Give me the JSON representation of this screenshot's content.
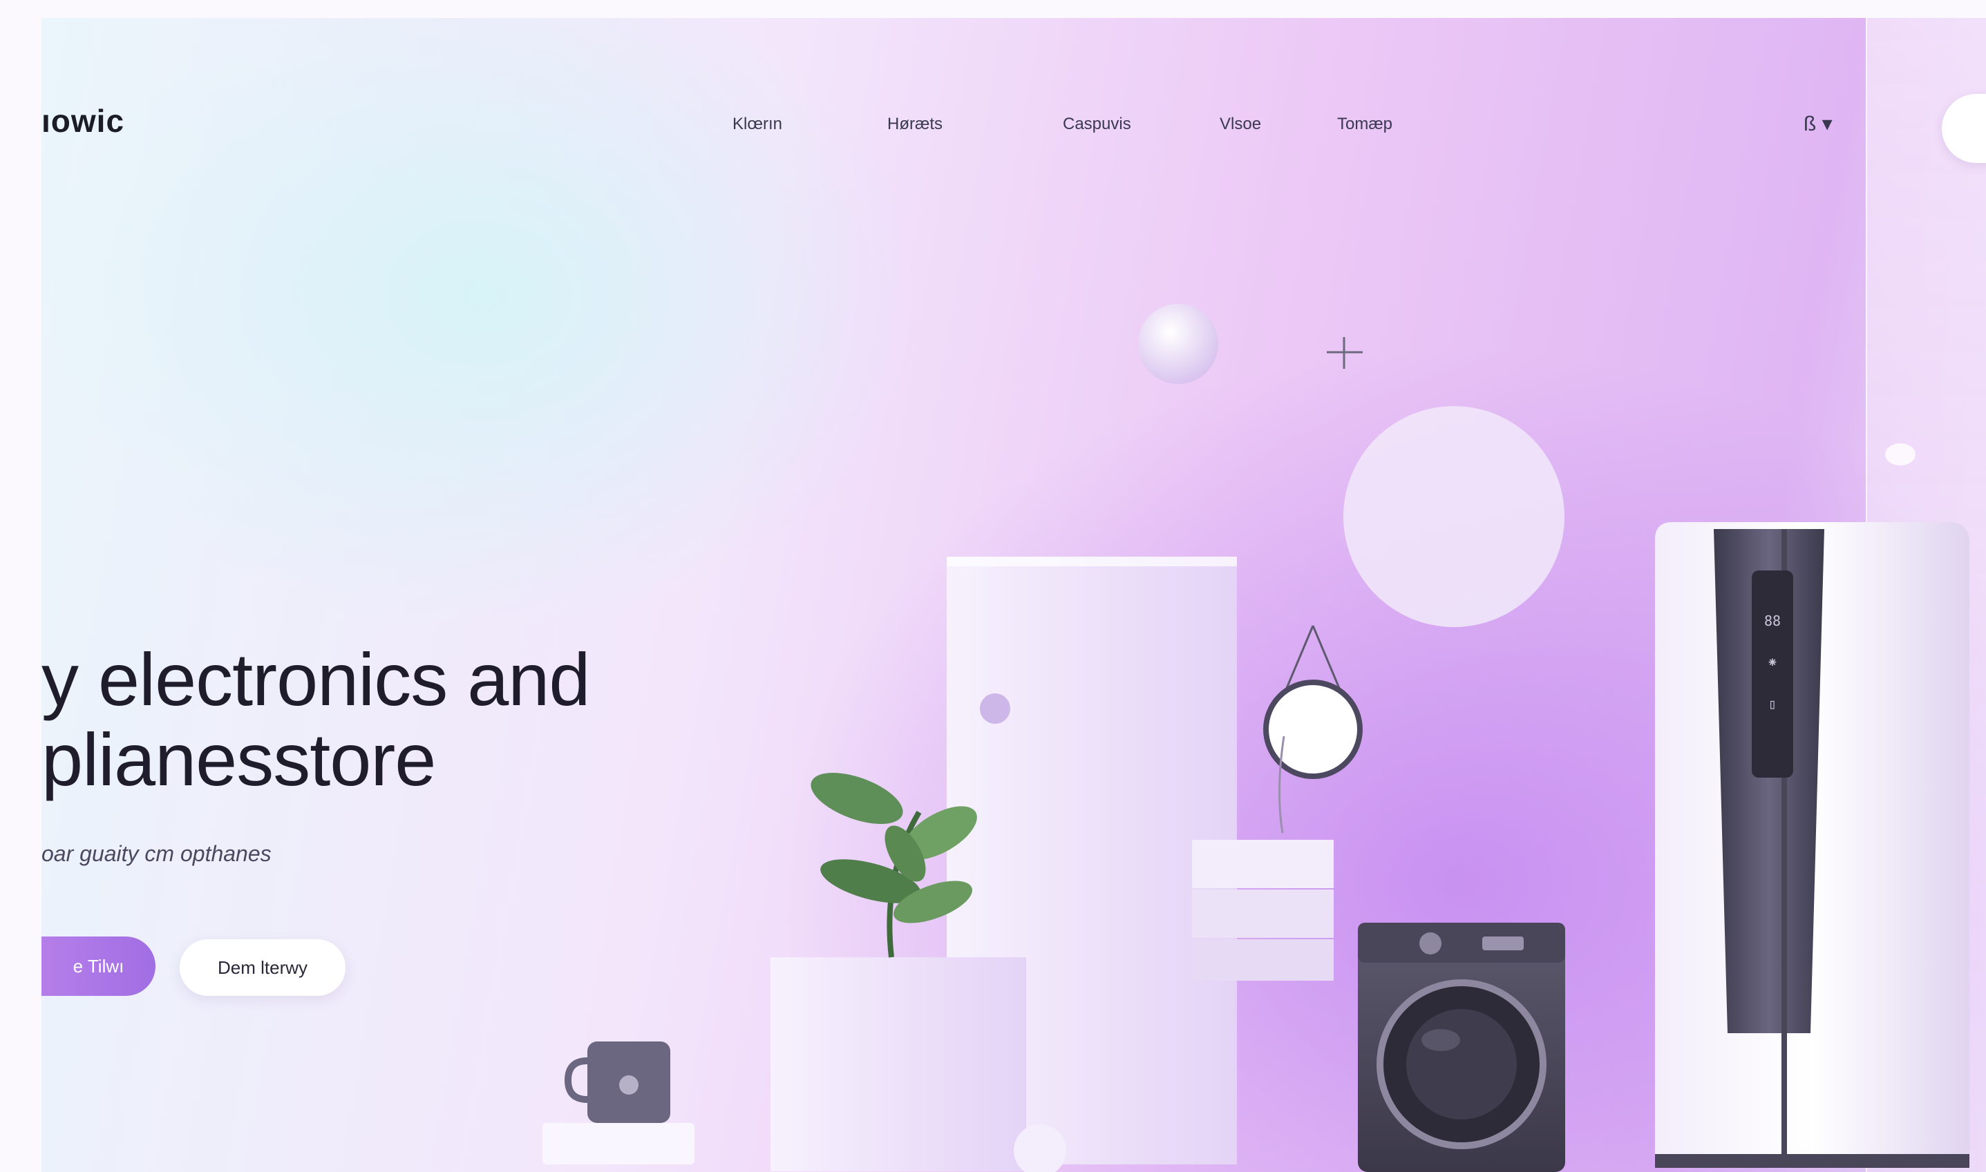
{
  "header": {
    "logo_text": "ıowic",
    "nav": [
      "Klœrın",
      "Høræts",
      "Caspuvis",
      "Vlsoe",
      "Tomæp"
    ],
    "user_menu": "ß ▾"
  },
  "hero": {
    "title_line1": "y electronics and",
    "title_line2": "plianesstore",
    "subtitle": "oar guaity cm opthanes",
    "primary_button": "e Tilwı",
    "secondary_button": "Dem lterwy"
  },
  "colors": {
    "accent": "#a977e6",
    "text_dark": "#1f1d2b",
    "background_gradient": [
      "#eaf6fb",
      "#ecc9f6",
      "#dfb6f3"
    ]
  }
}
